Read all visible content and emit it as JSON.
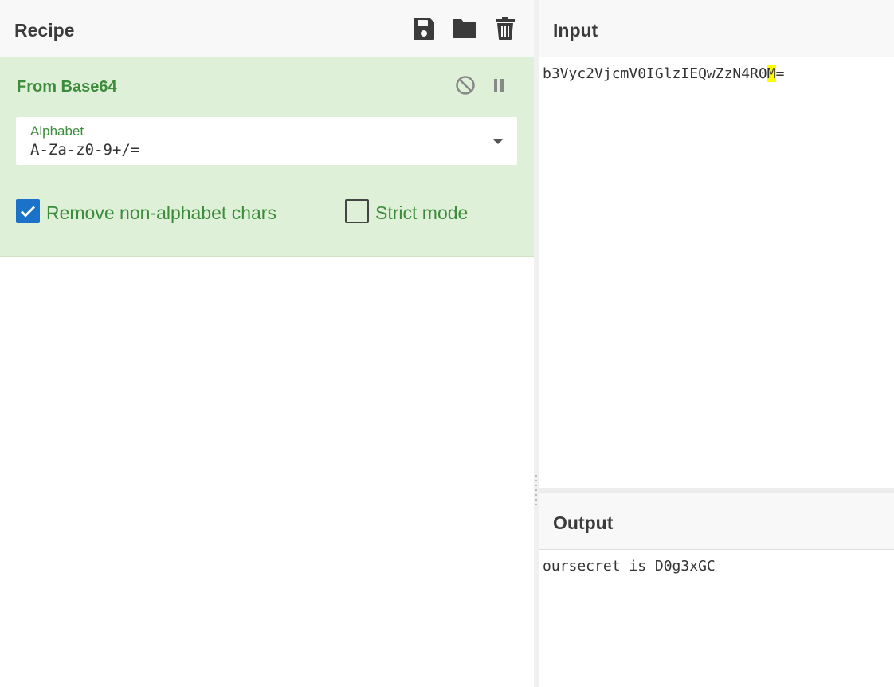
{
  "recipe": {
    "title": "Recipe",
    "icons": [
      "save-icon",
      "folder-icon",
      "trash-icon"
    ]
  },
  "operation": {
    "name": "From Base64",
    "icons": [
      "disable-icon",
      "pause-icon"
    ],
    "alphabet": {
      "label": "Alphabet",
      "value": "A-Za-z0-9+/="
    },
    "remove_non_alphabet": {
      "label": "Remove non-alphabet chars",
      "checked": true
    },
    "strict_mode": {
      "label": "Strict mode",
      "checked": false
    }
  },
  "input": {
    "title": "Input",
    "text_before": "b3Vyc2VjcmV0IGlzIEQwZzN4R0",
    "text_highlight": "M",
    "text_after": "="
  },
  "output": {
    "title": "Output",
    "text": "oursecret is D0g3xGC"
  },
  "colors": {
    "operation_bg": "#dff0d8",
    "operation_text": "#3c8c3c",
    "checkbox_on": "#1a73c9",
    "highlight": "#ffff00"
  }
}
